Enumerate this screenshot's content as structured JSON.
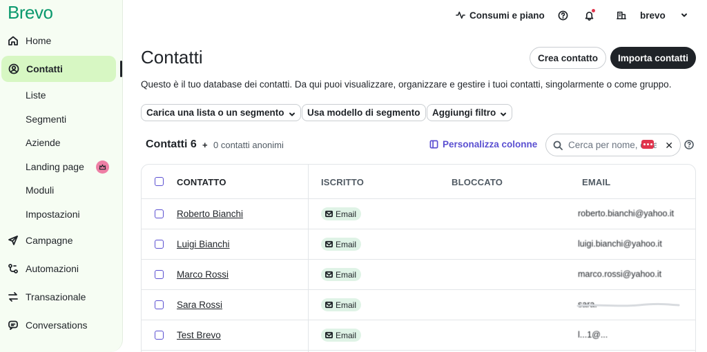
{
  "brand": {
    "logo": "Brevo",
    "color": "#0b996e"
  },
  "sidebar": {
    "items": [
      {
        "label": "Home",
        "icon": "home-icon"
      },
      {
        "label": "Contatti",
        "icon": "contacts-icon",
        "active": true
      },
      {
        "label": "Campagne",
        "icon": "send-icon"
      },
      {
        "label": "Automazioni",
        "icon": "automation-icon"
      },
      {
        "label": "Transazionale",
        "icon": "transactional-icon"
      },
      {
        "label": "Conversations",
        "icon": "chat-icon"
      }
    ],
    "subitems": [
      {
        "label": "Liste"
      },
      {
        "label": "Segmenti"
      },
      {
        "label": "Aziende"
      },
      {
        "label": "Landing page",
        "badge_icon": "crown-icon"
      },
      {
        "label": "Moduli"
      },
      {
        "label": "Impostazioni"
      }
    ]
  },
  "topbar": {
    "usage_label": "Consumi e piano",
    "account_label": "brevo"
  },
  "main": {
    "title": "Contatti",
    "create_label": "Crea contatto",
    "import_label": "Importa contatti",
    "description": "Questo è il tuo database dei contatti. Da qui puoi visualizzare, organizzare e gestire i tuoi contatti, singolarmente o come gruppo.",
    "filters": [
      {
        "label": "Carica una lista o un segmento"
      },
      {
        "label": "Usa modello di segmento"
      },
      {
        "label": "Aggiungi filtro"
      }
    ],
    "count_label": "Contatti 6",
    "plus": "+",
    "anon_label": "0 contatti anonimi",
    "customize_label": "Personalizza colonne",
    "search_placeholder": "Cerca per nome, email"
  },
  "table": {
    "headers": [
      "CONTATTO",
      "ISCRITTO",
      "BLOCCATO",
      "EMAIL"
    ],
    "rows": [
      {
        "name": "Roberto Bianchi",
        "subscribed": "Email",
        "email": "roberto.bianchi@yahoo.it"
      },
      {
        "name": "Luigi Bianchi",
        "subscribed": "Email",
        "email": "luigi.bianchi@yahoo.it"
      },
      {
        "name": "Marco Rossi",
        "subscribed": "Email",
        "email": "marco.rossi@yahoo.it"
      },
      {
        "name": "Sara Rossi",
        "subscribed": "Email",
        "email": "sara."
      },
      {
        "name": "Test Brevo",
        "subscribed": "Email",
        "email": "l...1@..."
      }
    ]
  },
  "colors": {
    "accent": "#5a4fd1",
    "active_bg": "#d7f7c3",
    "badge_bg": "#dff3e6",
    "primary_dark": "#1f2328"
  }
}
